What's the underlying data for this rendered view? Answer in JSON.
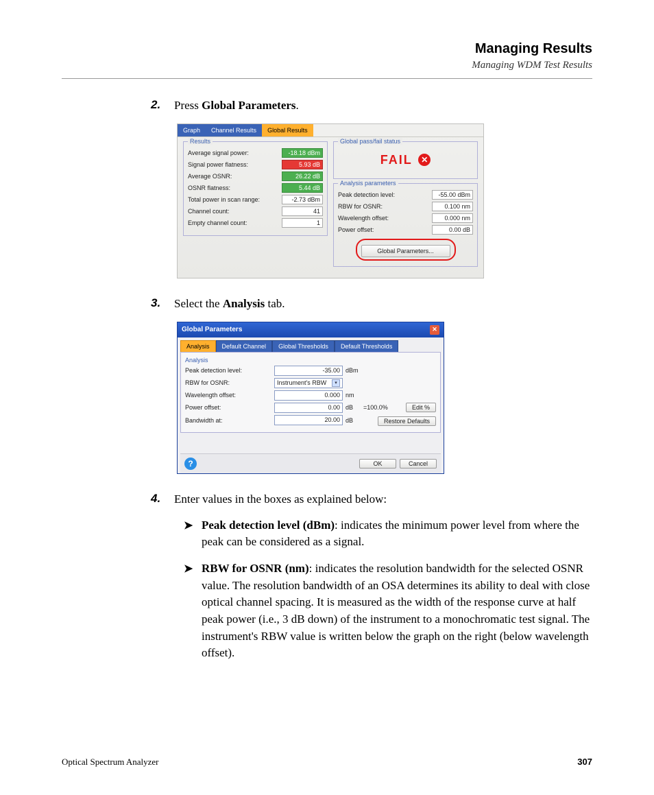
{
  "header": {
    "title": "Managing Results",
    "subtitle": "Managing WDM Test Results"
  },
  "steps": {
    "s2": {
      "num": "2.",
      "pre": "Press ",
      "bold": "Global Parameters",
      "post": "."
    },
    "s3": {
      "num": "3.",
      "pre": "Select the ",
      "bold": "Analysis",
      "post": " tab."
    },
    "s4": {
      "num": "4.",
      "text": "Enter values in the boxes as explained below:"
    }
  },
  "shot1": {
    "tabs": {
      "graph": "Graph",
      "channel": "Channel Results",
      "global": "Global Results"
    },
    "results_legend": "Results",
    "rows": {
      "avg_signal": {
        "label": "Average signal power:",
        "value": "-18.18 dBm"
      },
      "flatness": {
        "label": "Signal power flatness:",
        "value": "5.93 dB"
      },
      "avg_osnr": {
        "label": "Average OSNR:",
        "value": "26.22 dB"
      },
      "osnr_flat": {
        "label": "OSNR flatness:",
        "value": "5.44 dB"
      },
      "total_power": {
        "label": "Total power in scan range:",
        "value": "-2.73 dBm"
      },
      "chan_count": {
        "label": "Channel count:",
        "value": "41"
      },
      "empty_count": {
        "label": "Empty channel count:",
        "value": "1"
      }
    },
    "passfail_legend": "Global pass/fail status",
    "fail": "FAIL",
    "analysis_legend": "Analysis parameters",
    "analysis": {
      "peak": {
        "label": "Peak detection level:",
        "value": "-55.00 dBm"
      },
      "rbw": {
        "label": "RBW for OSNR:",
        "value": "0.100 nm"
      },
      "wloff": {
        "label": "Wavelength offset:",
        "value": "0.000 nm"
      },
      "poff": {
        "label": "Power offset:",
        "value": "0.00 dB"
      }
    },
    "gp_button": "Global Parameters..."
  },
  "shot2": {
    "title": "Global Parameters",
    "tabs": {
      "analysis": "Analysis",
      "defchan": "Default Channel",
      "gthresh": "Global Thresholds",
      "dthresh": "Default Thresholds"
    },
    "section": "Analysis",
    "rows": {
      "peak": {
        "label": "Peak detection level:",
        "value": "-35.00",
        "unit": "dBm"
      },
      "rbw": {
        "label": "RBW for OSNR:",
        "value": "Instrument's RBW"
      },
      "wloff": {
        "label": "Wavelength offset:",
        "value": "0.000",
        "unit": "nm"
      },
      "poff": {
        "label": "Power offset:",
        "value": "0.00",
        "unit": "dB",
        "pct": "=100.0%"
      },
      "bw": {
        "label": "Bandwidth at:",
        "value": "20.00",
        "unit": "dB"
      }
    },
    "edit_btn": "Edit %",
    "restore_btn": "Restore Defaults",
    "ok": "OK",
    "cancel": "Cancel"
  },
  "bullets": {
    "b1": {
      "bold": "Peak detection level (dBm)",
      "text": ": indicates the minimum power level from where the peak can be considered as a signal."
    },
    "b2": {
      "bold": "RBW for OSNR (nm)",
      "text": ": indicates the resolution bandwidth for the selected OSNR value. The resolution bandwidth of an OSA determines its ability to deal with close optical channel spacing. It is measured as the width of the response curve at half peak power (i.e., 3 dB down) of the instrument to a monochromatic test signal. The instrument's RBW value is written below the graph on the right (below wavelength offset)."
    }
  },
  "footer": {
    "product": "Optical Spectrum Analyzer",
    "page": "307"
  }
}
